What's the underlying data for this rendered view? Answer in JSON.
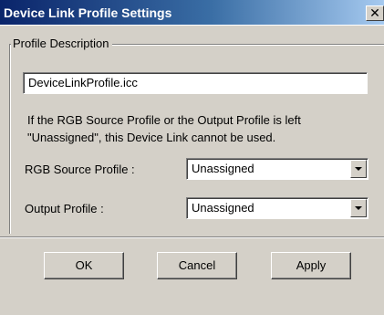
{
  "window": {
    "title": "Device Link Profile Settings",
    "close_glyph": "✕",
    "close_icon": "close-icon"
  },
  "profile_description": {
    "legend": "Profile Description",
    "value": "DeviceLinkProfile.icc"
  },
  "info_text": "If the RGB Source Profile or the Output Profile is left \"Unassigned\", this Device Link cannot be used.",
  "rgb_source": {
    "label": "RGB Source Profile :",
    "selected": "Unassigned"
  },
  "output_profile": {
    "label": "Output Profile :",
    "selected": "Unassigned"
  },
  "buttons": {
    "ok": "OK",
    "cancel": "Cancel",
    "apply": "Apply"
  },
  "colors": {
    "title_bar_start": "#0a246a",
    "title_bar_end": "#a6caf0",
    "dialog_background": "#d4d0c8"
  }
}
